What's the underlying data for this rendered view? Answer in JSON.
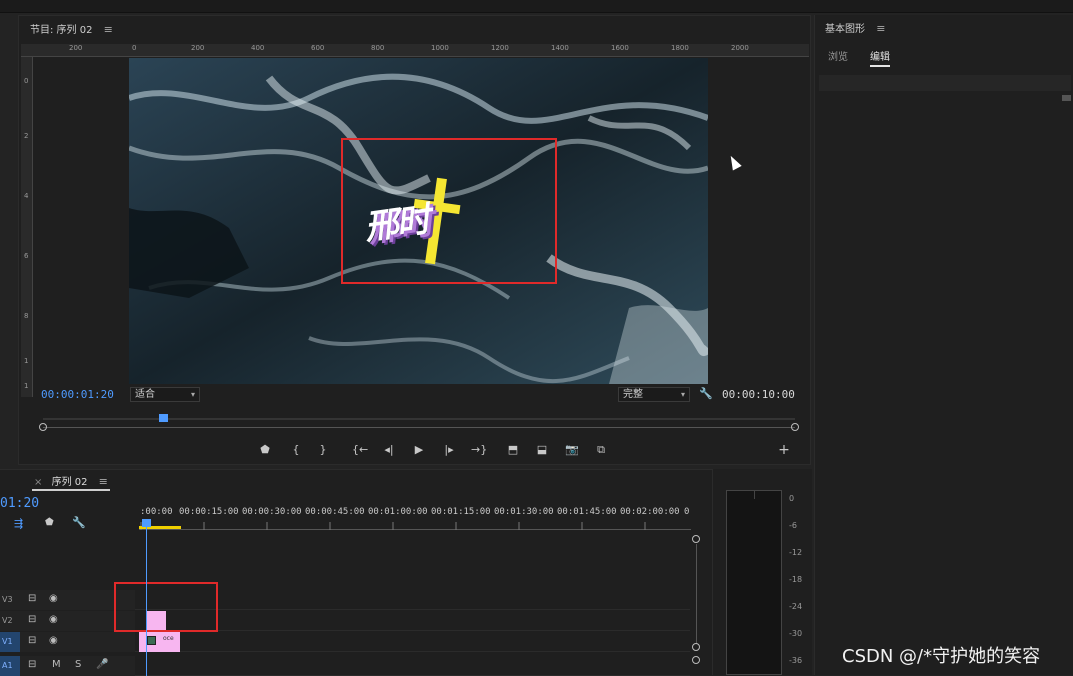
{
  "program_monitor": {
    "title": "节目: 序列 02",
    "menu_icon": "≡",
    "ruler_h": [
      "200",
      "0",
      "200",
      "400",
      "600",
      "800",
      "1000",
      "1200",
      "1400",
      "1600",
      "1800",
      "2000"
    ],
    "ruler_v": [
      "0",
      "2",
      "4",
      "6",
      "8",
      "1",
      "1"
    ],
    "current_time": "00:00:01:20",
    "duration": "00:00:10:00",
    "fit_label": "适合",
    "quality_label": "完整",
    "wrench_icon": "🔧",
    "title_overlay_text": "邢时",
    "controls": {
      "marker": "⬟",
      "mark_in": "{",
      "mark_out": "}",
      "go_in": "{←",
      "step_back": "◂|",
      "play": "▶",
      "step_fwd": "|▸",
      "go_out": "→}",
      "lift": "⬒",
      "extract": "⬓",
      "export_frame": "📷",
      "compare": "⧉",
      "add": "+"
    }
  },
  "essential_graphics": {
    "title": "基本图形",
    "menu_icon": "≡",
    "tabs": [
      "浏览",
      "编辑"
    ],
    "active_tab": "编辑"
  },
  "timeline": {
    "tab_close": "×",
    "tab_title": "序列 02",
    "menu_icon": "≡",
    "current_time_fragment": "01:20",
    "ruler_labels": [
      ":00:00",
      "00:00:15:00",
      "00:00:30:00",
      "00:00:45:00",
      "00:01:00:00",
      "00:01:15:00",
      "00:01:30:00",
      "00:01:45:00",
      "00:02:00:00",
      "0"
    ],
    "tracks": [
      {
        "name": "V3",
        "lock": "⊟",
        "eye": "◉"
      },
      {
        "name": "V2",
        "lock": "⊟",
        "eye": "◉"
      },
      {
        "name": "V1",
        "lock": "⊟",
        "eye": "◉"
      },
      {
        "name": "A1",
        "lock": "⊟",
        "m": "M",
        "s": "S",
        "mic": "🎤"
      }
    ],
    "clip_v1_name": "oce"
  },
  "audio_meter": {
    "db_labels": [
      "0",
      "-6",
      "-12",
      "-18",
      "-24",
      "-30",
      "-36"
    ]
  },
  "watermark": "CSDN @/*守护她的笑容"
}
